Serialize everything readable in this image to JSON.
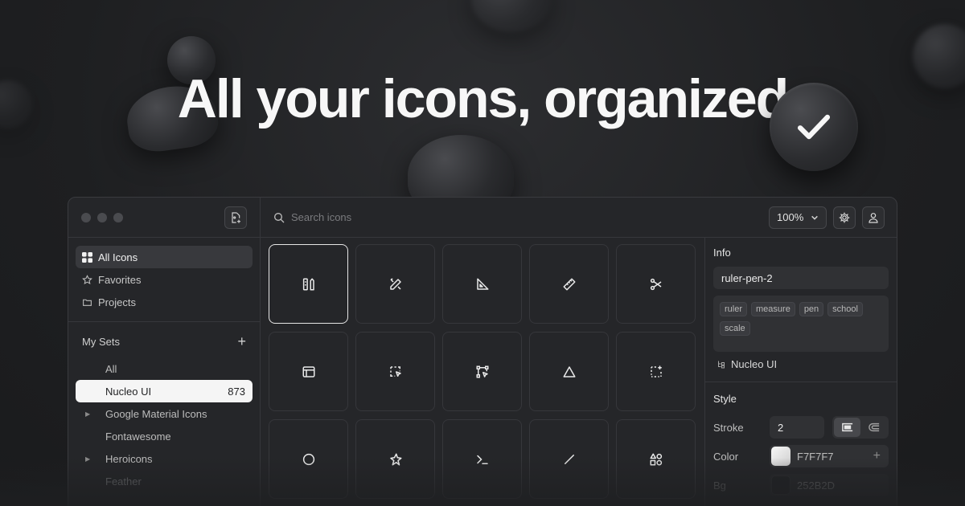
{
  "hero": {
    "title": "All your icons, organized"
  },
  "sidebar": {
    "nav": [
      {
        "label": "All Icons",
        "icon": "grid-icon",
        "active": true
      },
      {
        "label": "Favorites",
        "icon": "star-icon"
      },
      {
        "label": "Projects",
        "icon": "folder-icon"
      }
    ],
    "sets_title": "My Sets",
    "sets": [
      {
        "label": "All"
      },
      {
        "label": "Nucleo UI",
        "count": "873",
        "active": true
      },
      {
        "label": "Google Material Icons",
        "expandable": true
      },
      {
        "label": "Fontawesome"
      },
      {
        "label": "Heroicons",
        "expandable": true
      },
      {
        "label": "Feather"
      }
    ]
  },
  "topbar": {
    "search_placeholder": "Search icons",
    "zoom": "100%"
  },
  "grid": {
    "icons": [
      "ruler-pen-icon",
      "pen-ruler-icon",
      "set-square-icon",
      "ruler-icon",
      "scissors-icon",
      "window-icon",
      "select-cursor-icon",
      "vector-nodes-icon",
      "triangle-icon",
      "dashed-square-plus-icon",
      "circle-icon",
      "star-sparkle-icon",
      "terminal-icon",
      "line-icon",
      "shapes-icon"
    ],
    "selected_index": 0
  },
  "info": {
    "title": "Info",
    "name": "ruler-pen-2",
    "tags": [
      "ruler",
      "measure",
      "pen",
      "school",
      "scale"
    ],
    "set_name": "Nucleo UI"
  },
  "style": {
    "title": "Style",
    "stroke_label": "Stroke",
    "stroke_value": "2",
    "color_label": "Color",
    "color_value": "F7F7F7",
    "bg_label": "Bg",
    "bg_value": "252B2D"
  },
  "colors": {
    "accent": "#F7F7F7",
    "bg": "#252B2D"
  }
}
